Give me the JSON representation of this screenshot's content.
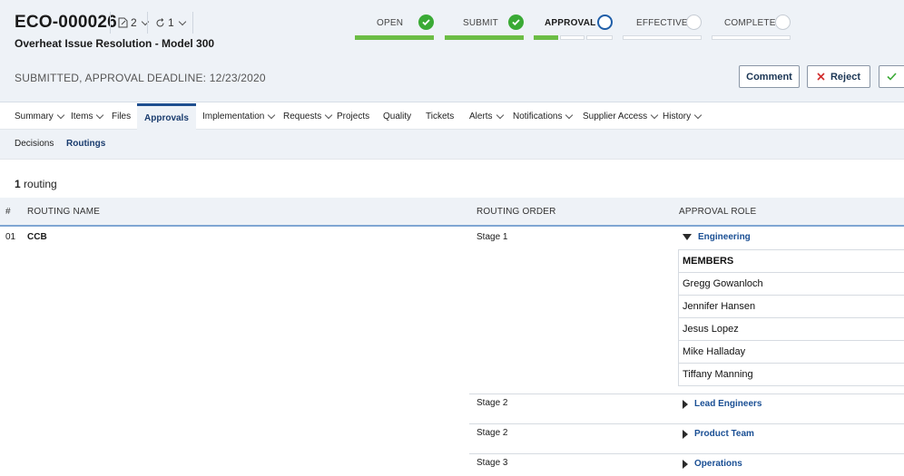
{
  "header": {
    "eco_id": "ECO-000026",
    "subtitle": "Overheat Issue Resolution - Model 300",
    "revision_count": "2",
    "cycle_count": "1",
    "status_line": "SUBMITTED, APPROVAL DEADLINE: 12/23/2020"
  },
  "workflow": {
    "steps": [
      {
        "label": "OPEN",
        "state": "done"
      },
      {
        "label": "SUBMIT",
        "state": "done"
      },
      {
        "label": "APPROVAL",
        "state": "current"
      },
      {
        "label": "EFFECTIVE",
        "state": "pending"
      },
      {
        "label": "COMPLETE",
        "state": "pending"
      }
    ]
  },
  "actions": {
    "comment": "Comment",
    "reject": "Reject"
  },
  "tabs": [
    {
      "label": "Summary",
      "dropdown": true
    },
    {
      "label": "Items",
      "dropdown": true
    },
    {
      "label": "Files",
      "dropdown": false
    },
    {
      "label": "Approvals",
      "dropdown": false,
      "active": true
    },
    {
      "label": "Implementation",
      "dropdown": true
    },
    {
      "label": "Requests",
      "dropdown": true
    },
    {
      "label": "Projects",
      "dropdown": false
    },
    {
      "label": "Quality",
      "dropdown": false
    },
    {
      "label": "Tickets",
      "dropdown": false
    },
    {
      "label": "Alerts",
      "dropdown": true
    },
    {
      "label": "Notifications",
      "dropdown": true
    },
    {
      "label": "Supplier Access",
      "dropdown": true
    },
    {
      "label": "History",
      "dropdown": true
    }
  ],
  "subtabs": [
    {
      "label": "Decisions"
    },
    {
      "label": "Routings",
      "active": true
    }
  ],
  "routing_count": {
    "number": "1",
    "text": "routing"
  },
  "table": {
    "columns": {
      "num": "#",
      "name": "ROUTING NAME",
      "order": "ROUTING ORDER",
      "role": "APPROVAL ROLE"
    },
    "row": {
      "num": "01",
      "name": "CCB"
    },
    "stages": [
      {
        "order": "Stage 1",
        "role": "Engineering",
        "expanded": true
      },
      {
        "order": "Stage 2",
        "role": "Lead Engineers",
        "expanded": false
      },
      {
        "order": "Stage 2",
        "role": "Product Team",
        "expanded": false
      },
      {
        "order": "Stage 3",
        "role": "Operations",
        "expanded": false
      }
    ],
    "members_header": "MEMBERS",
    "members": [
      "Gregg Gowanloch",
      "Jennifer Hansen",
      "Jesus Lopez",
      "Mike Halladay",
      "Tiffany Manning"
    ]
  },
  "colors": {
    "accent": "#1f4f8f",
    "done": "#3aaa35",
    "header_bg": "#eef2f7"
  }
}
